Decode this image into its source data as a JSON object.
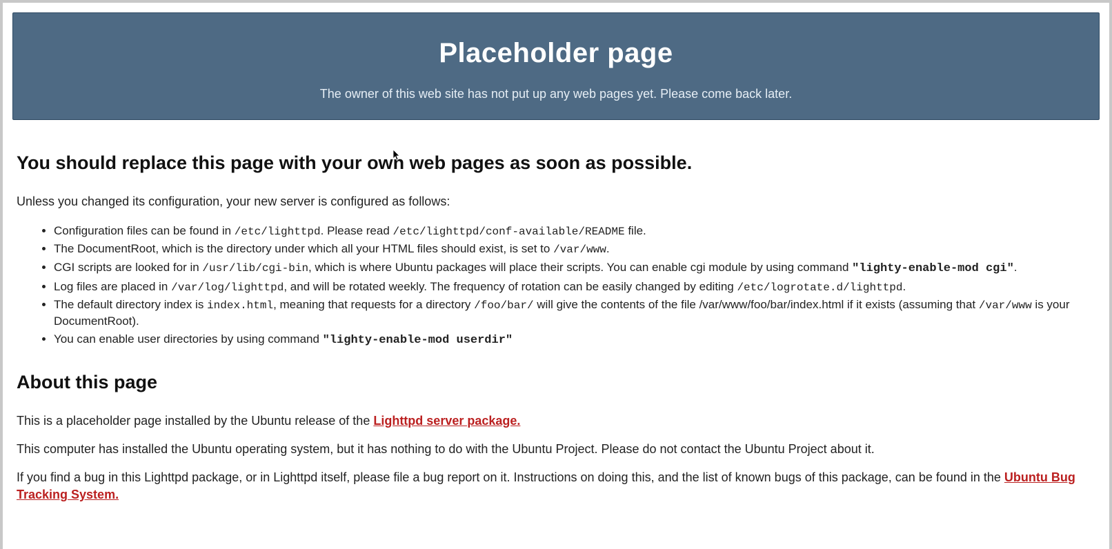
{
  "banner": {
    "title": "Placeholder page",
    "subtitle": "The owner of this web site has not put up any web pages yet. Please come back later."
  },
  "headline": "You should replace this page with your own web pages as soon as possible.",
  "intro": "Unless you changed its configuration, your new server is configured as follows:",
  "bullets": {
    "b1_pre": "Configuration files can be found in ",
    "b1_tt1": "/etc/lighttpd",
    "b1_mid": ". Please read ",
    "b1_tt2": "/etc/lighttpd/conf-available/README",
    "b1_post": " file.",
    "b2_pre": "The DocumentRoot, which is the directory under which all your HTML files should exist, is set to ",
    "b2_tt": "/var/www",
    "b2_post": ".",
    "b3_pre": "CGI scripts are looked for in ",
    "b3_tt1": "/usr/lib/cgi-bin",
    "b3_mid": ", which is where Ubuntu packages will place their scripts. You can enable cgi module by using command ",
    "b3_tt2": "\"lighty-enable-mod cgi\"",
    "b3_post": ".",
    "b4_pre": "Log files are placed in ",
    "b4_tt1": "/var/log/lighttpd",
    "b4_mid": ", and will be rotated weekly. The frequency of rotation can be easily changed by editing ",
    "b4_tt2": "/etc/logrotate.d/lighttpd",
    "b4_post": ".",
    "b5_pre": "The default directory index is ",
    "b5_tt1": "index.html",
    "b5_mid1": ", meaning that requests for a directory ",
    "b5_tt2": "/foo/bar/",
    "b5_mid2": " will give the contents of the file /var/www/foo/bar/index.html if it exists (assuming that ",
    "b5_tt3": "/var/www",
    "b5_post": " is your DocumentRoot).",
    "b6_pre": "You can enable user directories by using command ",
    "b6_tt": "\"lighty-enable-mod userdir\""
  },
  "about": {
    "heading": "About this page",
    "p1_pre": "This is a placeholder page installed by the Ubuntu release of the ",
    "p1_link": "Lighttpd server package.",
    "p2": "This computer has installed the Ubuntu operating system, but it has nothing to do with the Ubuntu Project. Please do not contact the Ubuntu Project about it.",
    "p3_pre": "If you find a bug in this Lighttpd package, or in Lighttpd itself, please file a bug report on it. Instructions on doing this, and the list of known bugs of this package, can be found in the ",
    "p3_link": "Ubuntu Bug Tracking System."
  }
}
